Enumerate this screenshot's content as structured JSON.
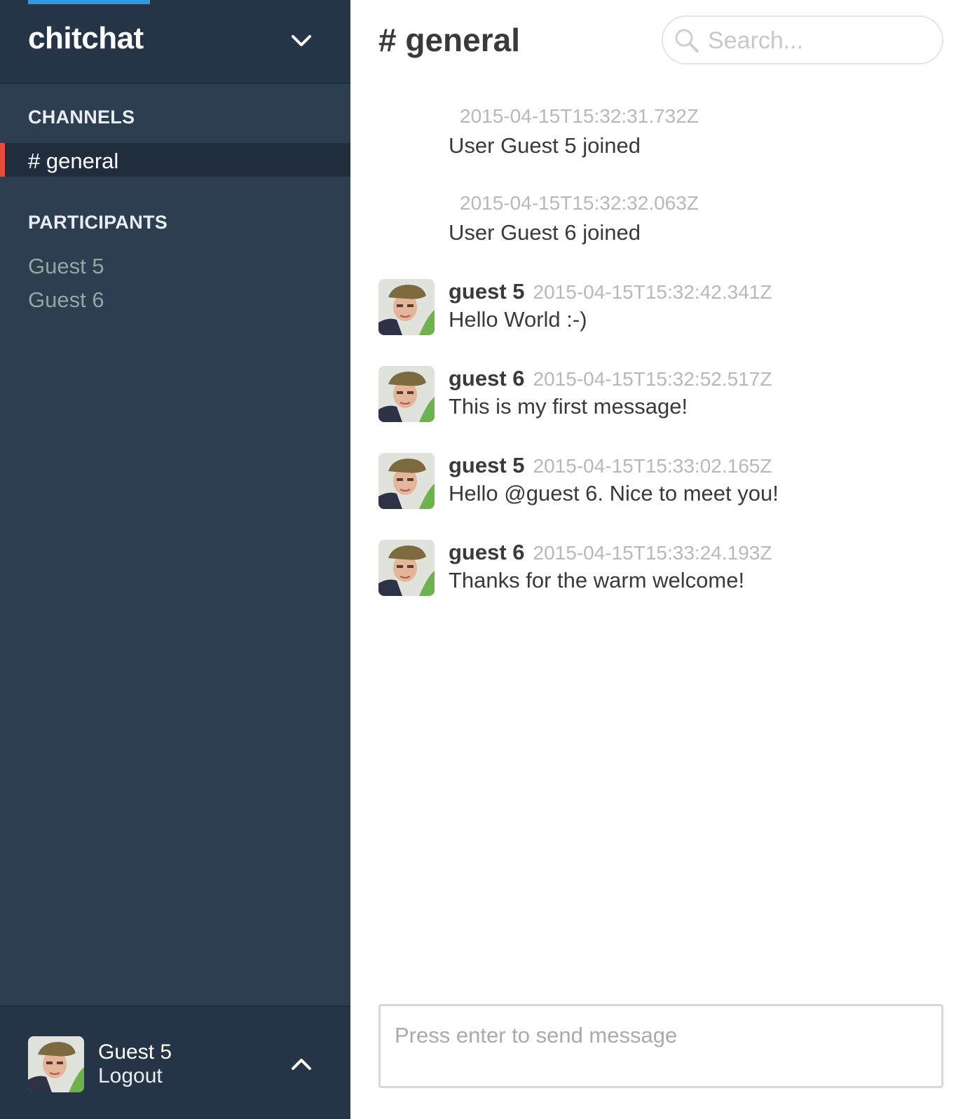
{
  "team": {
    "name": "chitchat",
    "accent_color": "#3498db"
  },
  "sidebar": {
    "channels_heading": "CHANNELS",
    "channels": [
      {
        "label": "# general",
        "active": true
      }
    ],
    "participants_heading": "PARTICIPANTS",
    "participants": [
      "Guest 5",
      "Guest 6"
    ],
    "background_color": "#2c3e50",
    "active_marker_color": "#e74c3c"
  },
  "current_user": {
    "name": "Guest 5",
    "logout_label": "Logout"
  },
  "main": {
    "channel_title": "# general",
    "search": {
      "placeholder": "Search..."
    },
    "messages": [
      {
        "type": "system",
        "timestamp": "2015-04-15T15:32:31.732Z",
        "text": "User Guest 5 joined"
      },
      {
        "type": "system",
        "timestamp": "2015-04-15T15:32:32.063Z",
        "text": "User Guest 6 joined"
      },
      {
        "type": "user",
        "user": "guest 5",
        "timestamp": "2015-04-15T15:32:42.341Z",
        "text": "Hello World :-)"
      },
      {
        "type": "user",
        "user": "guest 6",
        "timestamp": "2015-04-15T15:32:52.517Z",
        "text": "This is my first message!"
      },
      {
        "type": "user",
        "user": "guest 5",
        "timestamp": "2015-04-15T15:33:02.165Z",
        "text": "Hello @guest 6. Nice to meet you!"
      },
      {
        "type": "user",
        "user": "guest 6",
        "timestamp": "2015-04-15T15:33:24.193Z",
        "text": "Thanks for the warm welcome!"
      }
    ],
    "composer": {
      "placeholder": "Press enter to send message"
    }
  },
  "icons": {
    "team_toggle": "chevron-down-icon",
    "footer_toggle": "chevron-up-icon",
    "search": "search-icon"
  }
}
